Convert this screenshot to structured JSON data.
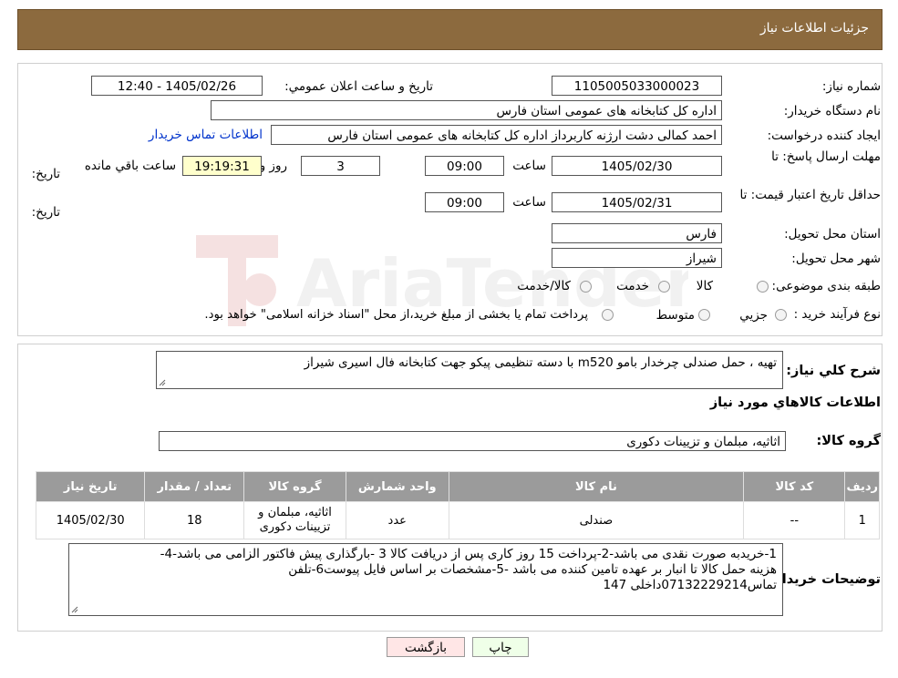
{
  "header": {
    "title": "جزئیات اطلاعات نیاز"
  },
  "watermark": {
    "text": "AriaTender.neT"
  },
  "form": {
    "need_number_label": "شماره نیاز:",
    "need_number": "1105005033000023",
    "announce_label": "تاریخ و ساعت اعلان عمومي:",
    "announce_value": "1405/02/26 - 12:40",
    "buyer_org_label": "نام دستگاه خریدار:",
    "buyer_org": "اداره کل کتابخانه های عمومی استان فارس",
    "creator_label": "ایجاد کننده درخواست:",
    "creator": "احمد  کمالی دشت ارژنه  کاربرداز اداره کل کتابخانه های عمومی استان فارس",
    "contact_link": "اطلاعات تماس خریدار",
    "deadline_label_line1": "مهلت ارسال پاسخ: تا",
    "deadline_label_line2": "تاریخ:",
    "deadline_date": "1405/02/30",
    "time_label": "ساعت",
    "deadline_time": "09:00",
    "days_value": "3",
    "days_label": "روز و",
    "remaining_time": "19:19:31",
    "remaining_label": "ساعت باقي مانده",
    "validity_label_line1": "حداقل تاریخ اعتبار قیمت: تا",
    "validity_label_line2": "تاریخ:",
    "validity_date": "1405/02/31",
    "validity_time": "09:00",
    "province_label": "استان محل تحویل:",
    "province": "فارس",
    "city_label": "شهر محل تحویل:",
    "city": "شیراز",
    "category_label": "طبقه بندی موضوعی:",
    "category_options": [
      "کالا",
      "خدمت",
      "کالا/خدمت"
    ],
    "process_label": "نوع فرآیند خرید :",
    "process_options": [
      "جزیي",
      "متوسط"
    ],
    "process_note": "پرداخت تمام یا بخشی از مبلغ خرید،از محل \"اسناد خزانه اسلامی\" خواهد بود."
  },
  "description": {
    "label": "شرح کلي نیاز:",
    "value": "تهیه ، حمل صندلی چرخدار بامو m520  با دسته تنظیمی پیکو جهت کتابخانه فال اسیری شیراز"
  },
  "goods_section_title": "اطلاعات کالاهاي مورد نیاز",
  "goods_group": {
    "label": "گروه کالا:",
    "value": "اثاثیه، مبلمان و تزیینات دکوری"
  },
  "table": {
    "headers": [
      "ردیف",
      "کد کالا",
      "نام کالا",
      "واحد شمارش",
      "گروه کالا",
      "تعداد / مقدار",
      "تاریخ نیاز"
    ],
    "rows": [
      {
        "row": "1",
        "code": "--",
        "name": "صندلی",
        "unit": "عدد",
        "group_line1": "اثاثیه، مبلمان و",
        "group_line2": "تزیینات دکوری",
        "qty": "18",
        "date": "1405/02/30"
      }
    ]
  },
  "buyer_notes": {
    "label": "توضیحات خریدار:",
    "line1": "1-خریدبه صورت نقدی می باشد-2-پرداخت 15 روز کاری پس از دریافت کالا  3 -بارگذاری پیش فاکتور الزامی می باشد-4-",
    "line2": "هزینه حمل کالا تا انبار بر عهده تامین کننده می باشد -5-مشخصات بر اساس فایل پیوست6-تلفن",
    "line3": "تماس07132229214داخلی 147"
  },
  "buttons": {
    "print": "چاپ",
    "back": "بازگشت"
  }
}
